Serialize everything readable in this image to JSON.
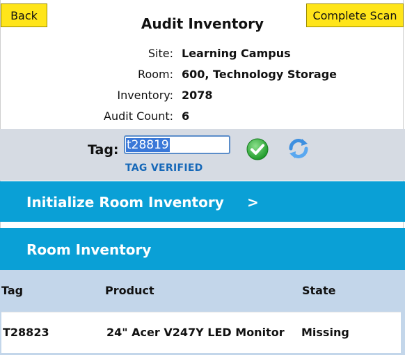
{
  "header": {
    "back_label": "Back",
    "complete_label": "Complete Scan",
    "title": "Audit Inventory"
  },
  "info": {
    "site_label": "Site:",
    "site_value": "Learning Campus",
    "room_label": "Room:",
    "room_value": "600, Technology Storage",
    "inventory_label": "Inventory:",
    "inventory_value": "2078",
    "audit_count_label": "Audit Count:",
    "audit_count_value": "6"
  },
  "tag": {
    "label": "Tag:",
    "value": "t28819",
    "status": "TAG VERIFIED",
    "icons": [
      "check-icon",
      "refresh-icon"
    ]
  },
  "sections": {
    "initialize_label": "Initialize Room Inventory",
    "initialize_chevron": ">",
    "room_inventory_label": "Room Inventory"
  },
  "table": {
    "columns": [
      "Tag",
      "Product",
      "State"
    ],
    "rows": [
      {
        "tag": "T28823",
        "product": "24\" Acer V247Y LED Monitor",
        "state": "Missing"
      }
    ]
  },
  "colors": {
    "button_yellow": "#ffe51a",
    "section_blue": "#0aa0d6",
    "tag_band": "#d6dbe3",
    "table_header": "#c3d6ea",
    "status_blue": "#1668b8",
    "check_green": "#2eae2e"
  }
}
